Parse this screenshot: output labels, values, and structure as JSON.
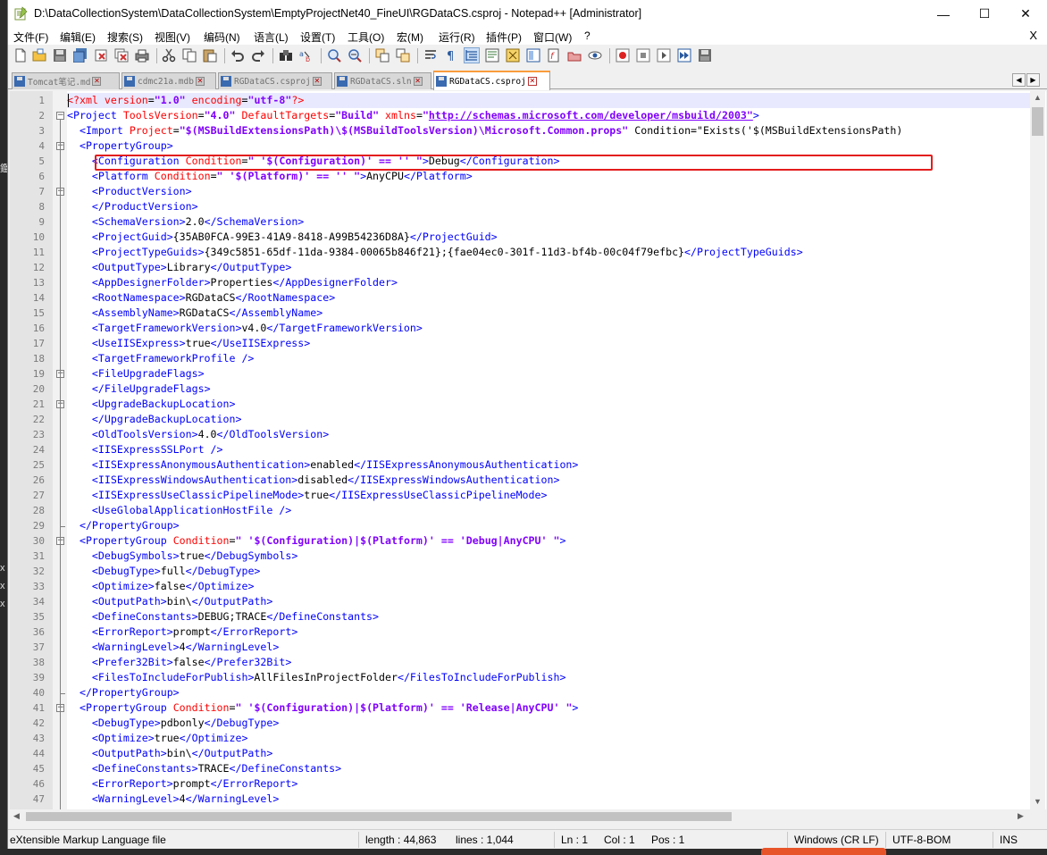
{
  "window": {
    "title": "D:\\DataCollectionSystem\\DataCollectionSystem\\EmptyProjectNet40_FineUI\\RGDataCS.csproj - Notepad++ [Administrator]",
    "minimize": "—",
    "maximize": "☐",
    "close": "✕"
  },
  "menu": {
    "items": [
      "文件(F)",
      "编辑(E)",
      "搜索(S)",
      "视图(V)",
      "编码(N)",
      "语言(L)",
      "设置(T)",
      "工具(O)",
      "宏(M)",
      "运行(R)",
      "插件(P)",
      "窗口(W)",
      "?"
    ],
    "close": "X"
  },
  "tabs": [
    {
      "label": "Tomcat笔记.md",
      "active": false
    },
    {
      "label": "cdmc21a.mdb",
      "active": false
    },
    {
      "label": "RGDataCS.csproj",
      "active": false
    },
    {
      "label": "RGDataCS.sln",
      "active": false
    },
    {
      "label": "RGDataCS.csproj",
      "active": true
    }
  ],
  "editor": {
    "line_numbers": [
      "1",
      "2",
      "3",
      "4",
      "5",
      "6",
      "7",
      "8",
      "9",
      "10",
      "11",
      "12",
      "13",
      "14",
      "15",
      "16",
      "17",
      "18",
      "19",
      "20",
      "21",
      "22",
      "23",
      "24",
      "25",
      "26",
      "27",
      "28",
      "29",
      "30",
      "31",
      "32",
      "33",
      "34",
      "35",
      "36",
      "37",
      "38",
      "39",
      "40",
      "41",
      "42",
      "43",
      "44",
      "45",
      "46",
      "47"
    ],
    "lines": [
      "<?xml version=\"1.0\" encoding=\"utf-8\"?>",
      "<Project ToolsVersion=\"4.0\" DefaultTargets=\"Build\" xmlns=\"http://schemas.microsoft.com/developer/msbuild/2003\">",
      "  <Import Project=\"$(MSBuildExtensionsPath)\\$(MSBuildToolsVersion)\\Microsoft.Common.props\" Condition=\"Exists('$(MSBuildExtensionsPath)",
      "  <PropertyGroup>",
      "    <Configuration Condition=\" '$(Configuration)' == '' \">Debug</Configuration>",
      "    <Platform Condition=\" '$(Platform)' == '' \">AnyCPU</Platform>",
      "    <ProductVersion>",
      "    </ProductVersion>",
      "    <SchemaVersion>2.0</SchemaVersion>",
      "    <ProjectGuid>{35AB0FCA-99E3-41A9-8418-A99B54236D8A}</ProjectGuid>",
      "    <ProjectTypeGuids>{349c5851-65df-11da-9384-00065b846f21};{fae04ec0-301f-11d3-bf4b-00c04f79efbc}</ProjectTypeGuids>",
      "    <OutputType>Library</OutputType>",
      "    <AppDesignerFolder>Properties</AppDesignerFolder>",
      "    <RootNamespace>RGDataCS</RootNamespace>",
      "    <AssemblyName>RGDataCS</AssemblyName>",
      "    <TargetFrameworkVersion>v4.0</TargetFrameworkVersion>",
      "    <UseIISExpress>true</UseIISExpress>",
      "    <TargetFrameworkProfile />",
      "    <FileUpgradeFlags>",
      "    </FileUpgradeFlags>",
      "    <UpgradeBackupLocation>",
      "    </UpgradeBackupLocation>",
      "    <OldToolsVersion>4.0</OldToolsVersion>",
      "    <IISExpressSSLPort />",
      "    <IISExpressAnonymousAuthentication>enabled</IISExpressAnonymousAuthentication>",
      "    <IISExpressWindowsAuthentication>disabled</IISExpressWindowsAuthentication>",
      "    <IISExpressUseClassicPipelineMode>true</IISExpressUseClassicPipelineMode>",
      "    <UseGlobalApplicationHostFile />",
      "  </PropertyGroup>",
      "  <PropertyGroup Condition=\" '$(Configuration)|$(Platform)' == 'Debug|AnyCPU' \">",
      "    <DebugSymbols>true</DebugSymbols>",
      "    <DebugType>full</DebugType>",
      "    <Optimize>false</Optimize>",
      "    <OutputPath>bin\\</OutputPath>",
      "    <DefineConstants>DEBUG;TRACE</DefineConstants>",
      "    <ErrorReport>prompt</ErrorReport>",
      "    <WarningLevel>4</WarningLevel>",
      "    <Prefer32Bit>false</Prefer32Bit>",
      "    <FilesToIncludeForPublish>AllFilesInProjectFolder</FilesToIncludeForPublish>",
      "  </PropertyGroup>",
      "  <PropertyGroup Condition=\" '$(Configuration)|$(Platform)' == 'Release|AnyCPU' \">",
      "    <DebugType>pdbonly</DebugType>",
      "    <Optimize>true</Optimize>",
      "    <OutputPath>bin\\</OutputPath>",
      "    <DefineConstants>TRACE</DefineConstants>",
      "    <ErrorReport>prompt</ErrorReport>",
      "    <WarningLevel>4</WarningLevel>"
    ],
    "highlighted_line": "11"
  },
  "status": {
    "language": "eXtensible Markup Language file",
    "length": "length : 44,863",
    "lines": "lines : 1,044",
    "ln": "Ln : 1",
    "col": "Col : 1",
    "pos": "Pos : 1",
    "eol": "Windows (CR LF)",
    "encoding": "UTF-8-BOM",
    "mode": "INS"
  },
  "colors": {
    "tag": "#0000ff",
    "attribute": "#ff0000",
    "value": "#8000ff",
    "highlight_box": "#e31d1d"
  }
}
